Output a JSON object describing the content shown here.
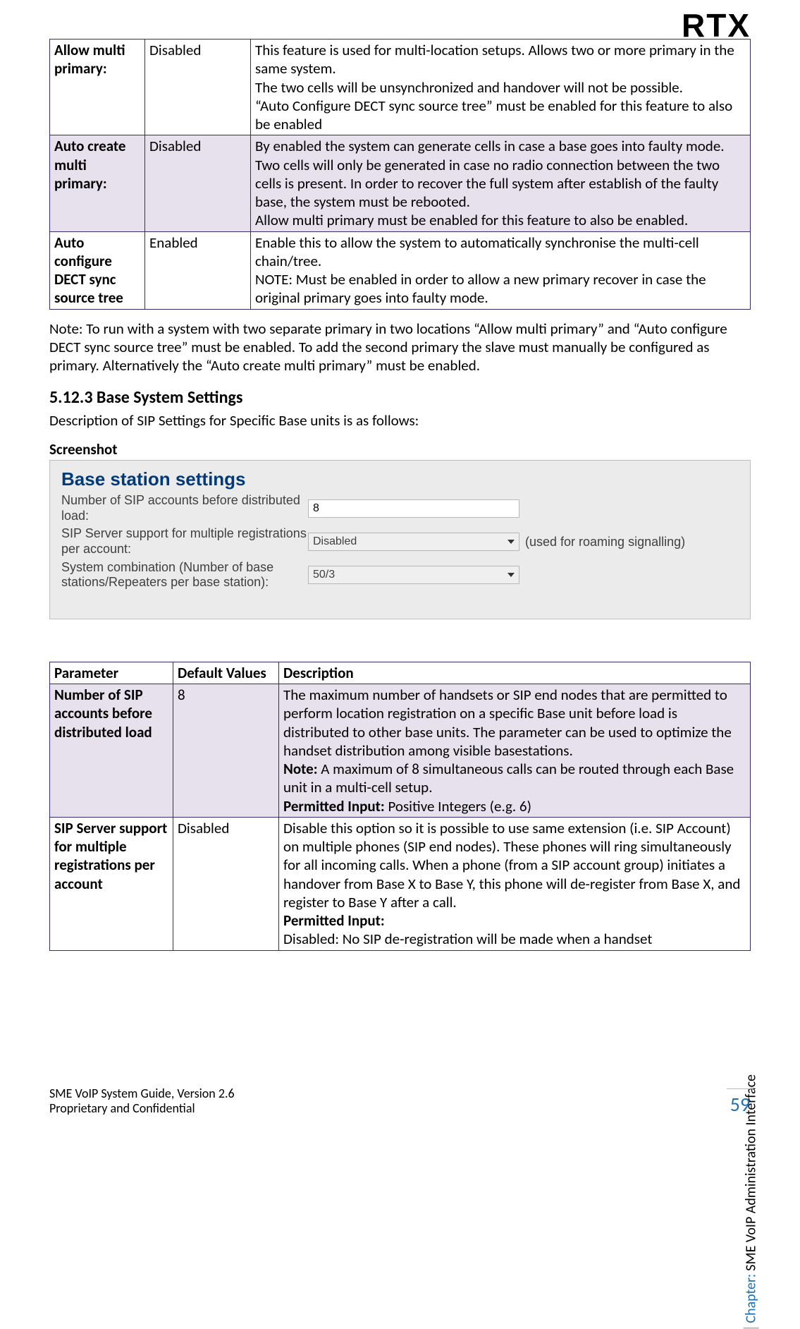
{
  "brand": "RTX",
  "table1": {
    "rows": [
      {
        "param": "Allow multi primary:",
        "default": "Disabled",
        "desc": "This feature is used for multi-location setups. Allows two or more primary in the same system.\nThe two cells will be unsynchronized and handover will not be possible.\n“Auto Configure DECT sync source tree” must be enabled for this feature to also be enabled",
        "shade": false
      },
      {
        "param": "Auto create multi primary:",
        "default": "Disabled",
        "desc": "By enabled the system can generate cells in case a base goes into faulty mode. Two cells will only be generated in case no radio connection between the two cells is present. In order to recover the full system after establish of the faulty base, the system must be rebooted.\nAllow multi primary must be enabled for this feature to also be enabled.",
        "shade": true
      },
      {
        "param": "Auto configure DECT sync source tree",
        "default": "Enabled",
        "desc": "Enable this to allow the system to automatically synchronise the multi-cell chain/tree.\nNOTE: Must be enabled in order to allow a new primary recover in case the original primary goes into faulty mode.",
        "shade": false
      }
    ]
  },
  "note_text": "Note: To run with a system with two separate primary in two locations “Allow multi primary” and “Auto configure DECT sync source tree” must be enabled. To add the second primary the slave must manually be configured as primary. Alternatively the “Auto create multi primary” must be enabled.",
  "heading": "5.12.3 Base System Settings",
  "subheading": "Description of SIP Settings for Specific Base units is as follows:",
  "screenshot_label": "Screenshot",
  "screenshot": {
    "title": "Base station settings",
    "row1_label": "Number of SIP accounts before distributed load:",
    "row1_value": "8",
    "row2_label": "SIP Server support for multiple registrations per account:",
    "row2_value": "Disabled",
    "row2_hint": "(used for roaming signalling)",
    "row3_label": "System combination (Number of base stations/Repeaters per base station):",
    "row3_value": "50/3"
  },
  "table2": {
    "header": {
      "a": "Parameter",
      "b": "Default Values",
      "c": "Description"
    },
    "rows": [
      {
        "param": "Number of SIP accounts before distributed load",
        "default": "8",
        "desc_main": "The maximum number of handsets or SIP end nodes that are permitted to perform location registration on a specific Base unit before load is distributed to other base units. The parameter can be used to optimize the handset distribution among visible basestations.",
        "note_label": "Note:",
        "note_text": " A maximum of 8 simultaneous calls can be routed through each Base unit in a multi-cell setup.",
        "perm_label": "Permitted Input:",
        "perm_text": " Positive Integers (e.g. 6)",
        "shade": true
      },
      {
        "param": "SIP Server support for multiple registrations per account",
        "default": "Disabled",
        "desc_main": "Disable this option so it is possible to use same extension (i.e. SIP Account) on multiple phones (SIP end nodes). These phones will ring simultaneously for all incoming calls. When a phone (from a SIP account group) initiates a handover from Base X to Base Y, this phone will de-register from Base X, and register to Base Y after a call.",
        "perm_label": "Permitted Input:",
        "perm_tail": "Disabled: No SIP de-registration will be made when a handset",
        "shade": false
      }
    ]
  },
  "footer": {
    "line1": "SME VoIP System Guide, Version 2.6",
    "line2": "Proprietary and Confidential"
  },
  "page_number": "59",
  "chapter_label": "Chapter:",
  "chapter_text": " SME VoIP Administration Interface"
}
